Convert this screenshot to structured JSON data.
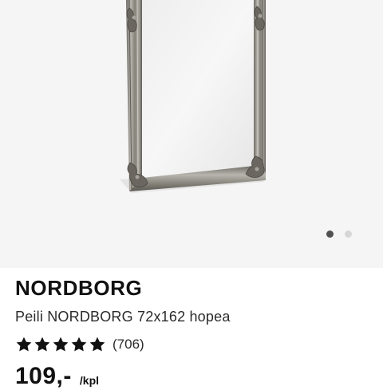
{
  "product": {
    "name": "NORDBORG",
    "description": "Peili NORDBORG 72x162 hopea",
    "rating": {
      "stars": 5,
      "max": 5,
      "count_label": "(706)"
    },
    "price": {
      "value": "109,-",
      "unit": "/kpl"
    }
  },
  "gallery": {
    "image_count": 2,
    "active_index": 0
  },
  "colors": {
    "gallery_background": "#f5f5f5",
    "frame_silver": "#8a8780",
    "star": "#111111",
    "dot_active": "#505050",
    "dot_inactive": "#d6d6d6"
  },
  "icons": [
    "star-icon"
  ]
}
